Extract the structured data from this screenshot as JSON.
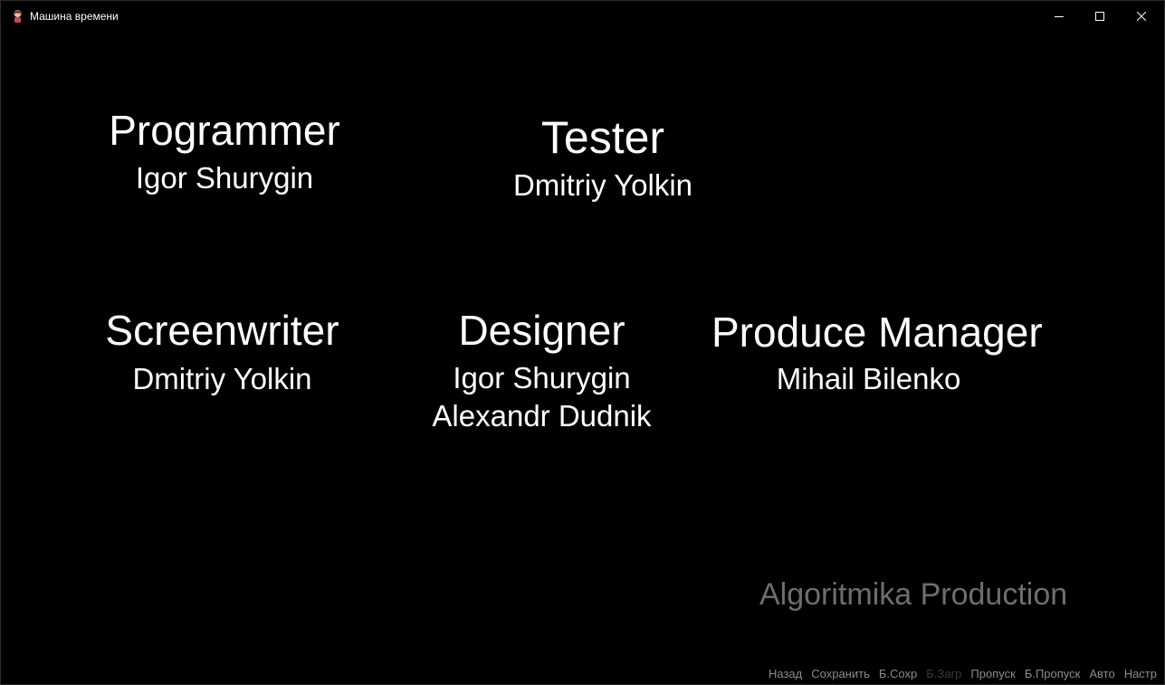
{
  "window": {
    "title": "Машина времени",
    "icon": "game-character-icon"
  },
  "credits": {
    "programmer": {
      "role": "Programmer",
      "names": [
        "Igor Shurygin"
      ]
    },
    "tester": {
      "role": "Tester",
      "names": [
        "Dmitriy Yolkin"
      ]
    },
    "screenwriter": {
      "role": "Screenwriter",
      "names": [
        "Dmitriy Yolkin"
      ]
    },
    "designer": {
      "role": "Designer",
      "names": [
        "Igor Shurygin",
        "Alexandr Dudnik"
      ]
    },
    "produce_manager": {
      "role": "Produce Manager",
      "names": [
        "Mihail Bilenko"
      ]
    }
  },
  "studio": "Algoritmika Production",
  "quick_menu": {
    "back": "Назад",
    "save": "Сохранить",
    "quick_save": "Б.Сохр",
    "quick_load": "Б.Загр",
    "skip": "Пропуск",
    "fast_skip": "Б.Пропуск",
    "auto": "Авто",
    "settings": "Настр"
  },
  "colors": {
    "background": "#000000",
    "text": "#ffffff",
    "studio_text": "#6e6e6e",
    "menu_text": "#8c8c8c",
    "menu_disabled": "#3c3c3c"
  }
}
